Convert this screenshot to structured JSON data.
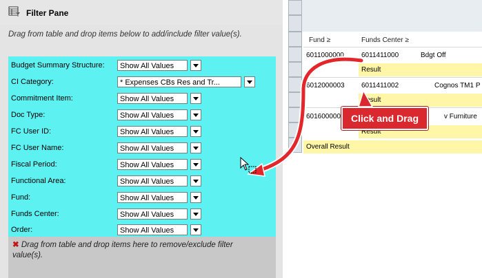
{
  "pane": {
    "title": "Filter Pane",
    "drag_instruction": "Drag from table and drop items below to add/include filter value(s).",
    "remove_instruction": "Drag from table and drop items here to remove/exclude filter value(s)."
  },
  "filters": [
    {
      "label": "Budget Summary Structure:",
      "value": "Show All Values"
    },
    {
      "label": "CI Category:",
      "value": "* Expenses CBs Res and Tr..."
    },
    {
      "label": "Commitment Item:",
      "value": "Show All Values"
    },
    {
      "label": "Doc Type:",
      "value": "Show All Values"
    },
    {
      "label": "FC User ID:",
      "value": "Show All Values"
    },
    {
      "label": "FC User Name:",
      "value": "Show All Values"
    },
    {
      "label": "Fiscal Period:",
      "value": "Show All Values"
    },
    {
      "label": "Functional Area:",
      "value": "Show All Values"
    },
    {
      "label": "Fund:",
      "value": "Show All Values"
    },
    {
      "label": "Funds Center:",
      "value": "Show All Values"
    },
    {
      "label": "Order:",
      "value": "Show All Values"
    }
  ],
  "grid": {
    "headers": [
      "Fund ≥",
      "Funds Center ≥"
    ],
    "rows": [
      {
        "fund": "6011000000",
        "center": "6011411000",
        "desc": "Bdgt Off"
      },
      {
        "result": "Result"
      },
      {
        "fund": "6012000003",
        "center": "6011411002",
        "desc": "Cognos TM1 P"
      },
      {
        "result": "Result"
      },
      {
        "fund": "6016000000",
        "center": "",
        "desc": "v Furniture"
      },
      {
        "result": "Result"
      }
    ],
    "overall": "Overall Result"
  },
  "callout": {
    "text": "Click and Drag"
  },
  "colors": {
    "filter_area": "#5ef1f1",
    "result_row": "#fff6a8",
    "arrow": "#e3262b"
  }
}
